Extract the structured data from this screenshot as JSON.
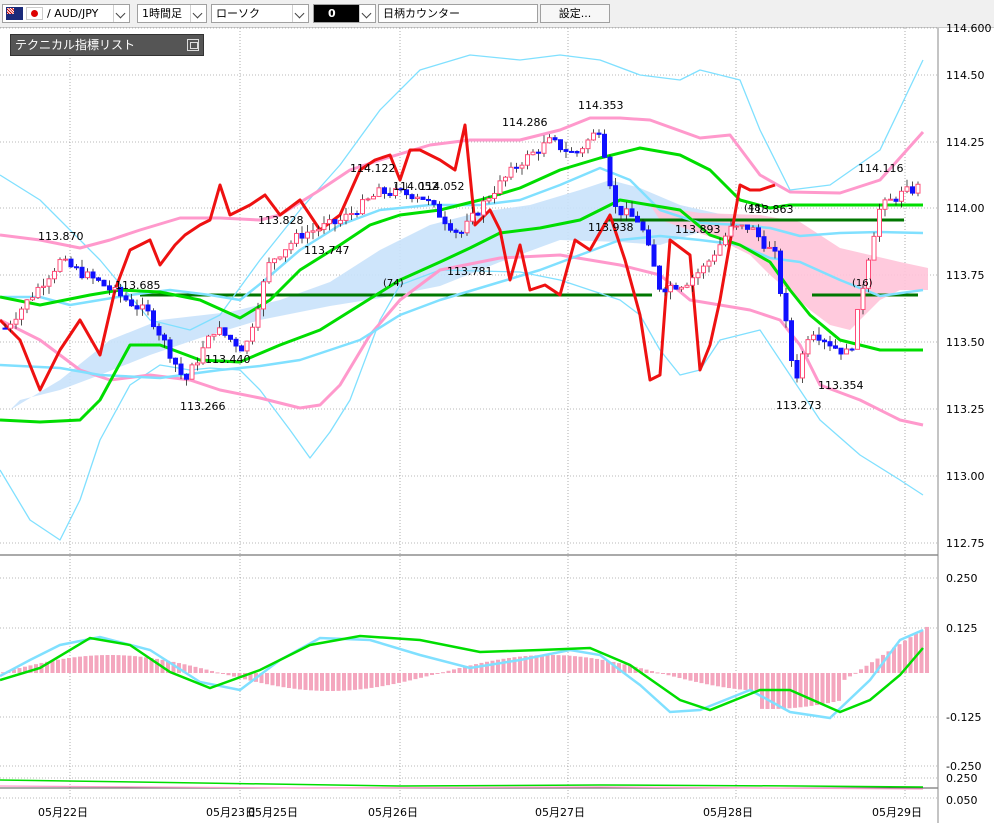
{
  "toolbar": {
    "pair": "/ AUD/JPY",
    "period": "1時間足",
    "chart_type": "ローソク",
    "color_value": "0",
    "counter": "日柄カウンター",
    "settings": "設定..."
  },
  "indicator_panel": {
    "label": "テクニカル指標リスト"
  },
  "colors": {
    "up_candle": "#ff4d79",
    "down_candle": "#1010ff",
    "bb_outer": "#80e0ff",
    "bb_inner": "#ff99cc",
    "ma_green": "#00dd00",
    "red_line": "#ee1111",
    "support_line": "#007700",
    "cloud_blue": "#c9e2fb",
    "cloud_pink": "#ffc4d9"
  },
  "chart_data": {
    "type": "line",
    "price_axis": [
      "114.50",
      "114.25",
      "114.00",
      "113.75",
      "113.50",
      "113.25",
      "113.00",
      "112.75"
    ],
    "price_axis_top_partial": "114.600",
    "macd_axis": [
      "0.250",
      "0.125",
      "-0.125",
      "-0.250"
    ],
    "sub_axis": [
      "0.250",
      "0.050"
    ],
    "x_labels": [
      "05月22日",
      "05月23日",
      "05月25日",
      "05月26日",
      "05月27日",
      "05月28日",
      "05月29日"
    ],
    "price_labels": [
      "113.870",
      "113.685",
      "113.440",
      "113.266",
      "113.828",
      "113.747",
      "114.122",
      "114.052",
      "114.052",
      "114.286",
      "113.781",
      "114.353",
      "113.938",
      "113.893",
      "113.863",
      "113.273",
      "113.354",
      "114.116"
    ],
    "annotations": [
      "(74)",
      "(48)",
      "(16)"
    ]
  }
}
